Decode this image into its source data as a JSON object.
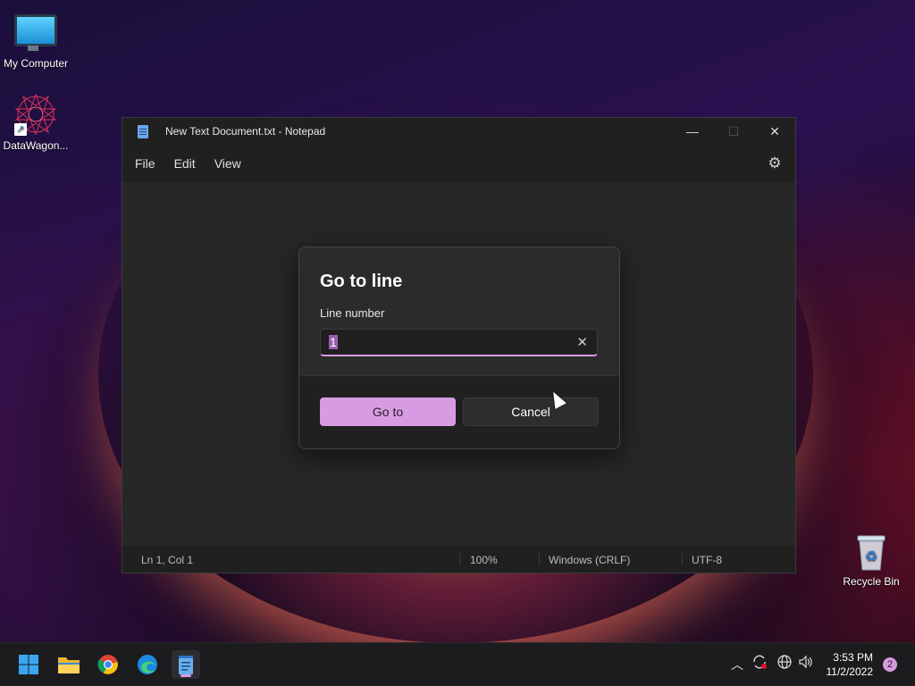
{
  "desktop": {
    "icons": [
      {
        "label": "My Computer"
      },
      {
        "label": "DataWagon..."
      },
      {
        "label": "Recycle Bin"
      }
    ]
  },
  "window": {
    "title": "New Text Document.txt - Notepad",
    "controls": {
      "minimize": "—",
      "maximize": "☐",
      "close": "✕"
    },
    "menu": [
      "File",
      "Edit",
      "View"
    ],
    "settings_icon": "gear-icon"
  },
  "status": {
    "position": "Ln 1, Col 1",
    "zoom": "100%",
    "line_ending": "Windows (CRLF)",
    "encoding": "UTF-8"
  },
  "dialog": {
    "title": "Go to line",
    "label": "Line number",
    "value": "1",
    "clear_glyph": "✕",
    "goto_label": "Go to",
    "cancel_label": "Cancel",
    "accent": "#d79be2"
  },
  "taskbar": {
    "apps": [
      "start-icon",
      "file-explorer-icon",
      "chrome-icon",
      "edge-icon",
      "notepad-icon"
    ],
    "clock_time": "3:53 PM",
    "clock_date": "11/2/2022",
    "notification_count": "2"
  }
}
